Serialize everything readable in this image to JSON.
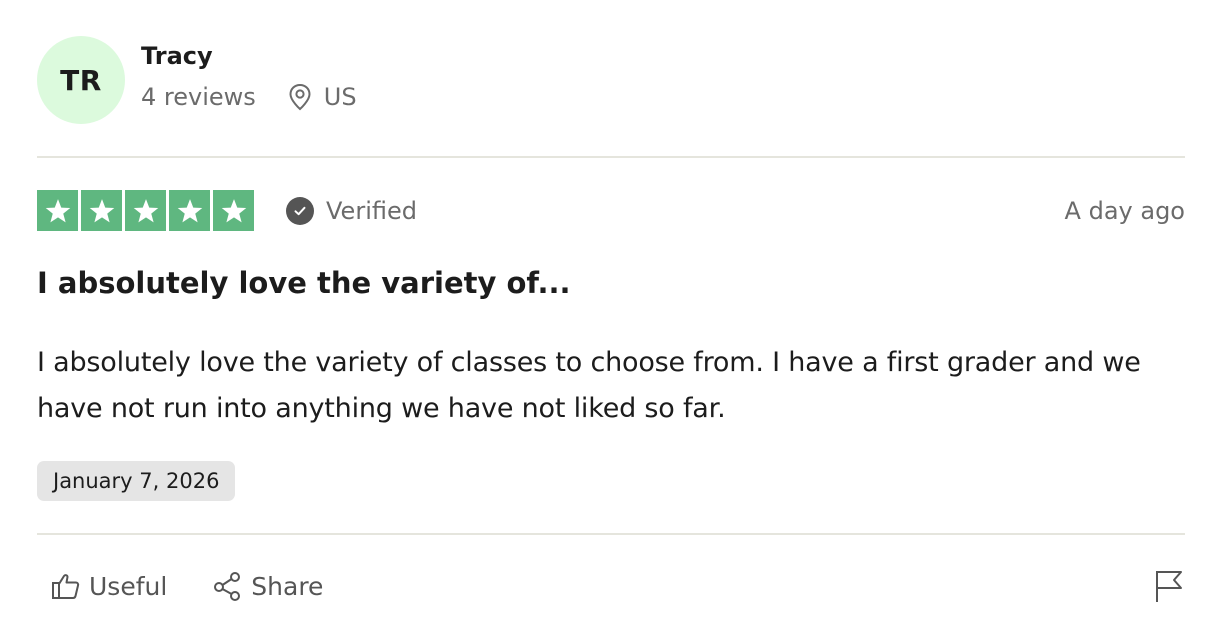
{
  "reviewer": {
    "initials": "TR",
    "name": "Tracy",
    "reviews_count": "4 reviews",
    "location": "US",
    "avatar_color": "#dcfadd",
    "location_icon": "location-pin-icon"
  },
  "rating": {
    "stars": 5,
    "max_stars": 5,
    "star_color": "#5fb780",
    "verified_label": "Verified",
    "verified_icon": "check-circle-icon",
    "time_ago": "A day ago"
  },
  "review": {
    "title": "I absolutely love the variety of...",
    "body": "I absolutely love the variety of classes to choose from. I have a first grader and we have not run into anything we have not liked so far.",
    "date": "January 7, 2026"
  },
  "actions": {
    "useful_label": "Useful",
    "useful_icon": "thumbs-up-icon",
    "share_label": "Share",
    "share_icon": "share-icon",
    "flag_icon": "flag-icon"
  }
}
